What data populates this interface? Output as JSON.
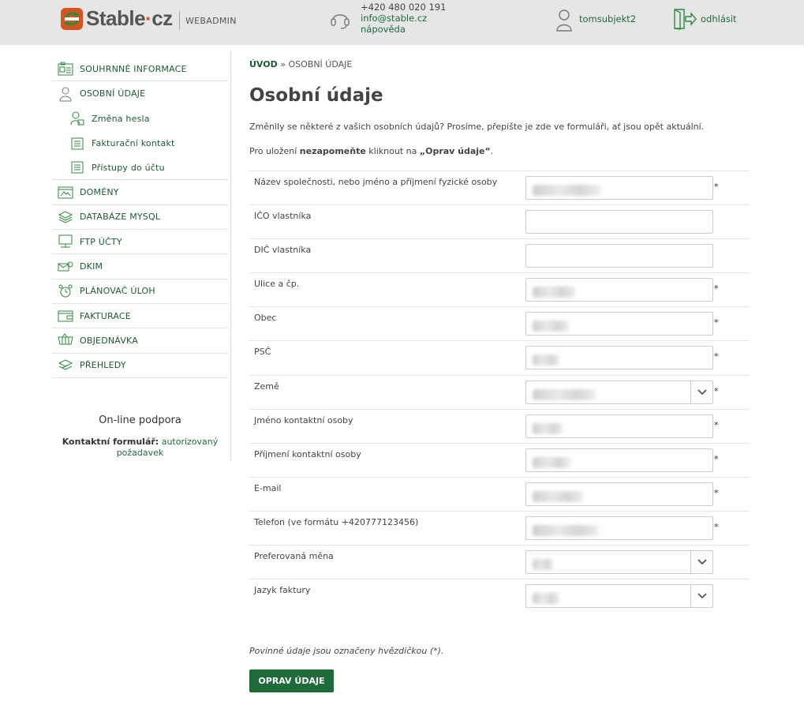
{
  "header": {
    "logo_text_main": "Stable",
    "logo_text_dot": "·",
    "logo_text_tld": "cz",
    "logo_sub": "WEBADMIN",
    "phone": "+420 480 020 191",
    "email": "info@stable.cz",
    "help": "nápověda",
    "username": "tomsubjekt2",
    "logout": "odhlásit"
  },
  "sidebar": {
    "items": [
      {
        "label": "SOUHRNNÉ INFORMACE",
        "icon": "summary-icon"
      },
      {
        "label": "OSOBNÍ ÚDAJE",
        "icon": "person-icon"
      },
      {
        "label": "Změna hesla",
        "icon": "password-user-icon"
      },
      {
        "label": "Fakturační kontakt",
        "icon": "document-icon"
      },
      {
        "label": "Přístupy do účtu",
        "icon": "document-icon"
      },
      {
        "label": "DOMÉNY",
        "icon": "domain-icon"
      },
      {
        "label": "DATABÁZE MYSQL",
        "icon": "database-icon"
      },
      {
        "label": "FTP ÚČTY",
        "icon": "ftp-icon"
      },
      {
        "label": "DKIM",
        "icon": "dkim-icon"
      },
      {
        "label": "PLÁNOVAČ ÚLOH",
        "icon": "alarm-clock-icon"
      },
      {
        "label": "FAKTURACE",
        "icon": "wallet-icon"
      },
      {
        "label": "OBJEDNÁVKA",
        "icon": "cart-icon"
      },
      {
        "label": "PŘEHLEDY",
        "icon": "stats-icon"
      }
    ],
    "support_title": "On-line podpora",
    "support_label": "Kontaktní formulář:",
    "support_link": "autorizovaný požadavek"
  },
  "main": {
    "breadcrumb_home": "ÚVOD",
    "breadcrumb_sep": " » ",
    "breadcrumb_current": "OSOBNÍ ÚDAJE",
    "title": "Osobní údaje",
    "intro": "Změnily se některé z vašich osobních údajů? Prosíme, přepište je zde ve formuláři, ať jsou opět aktuální.",
    "notice_pre": "Pro uložení ",
    "notice_bold": "nezapomeňte",
    "notice_mid": " kliknout na ",
    "notice_btn": "„Oprav údaje“",
    "notice_end": ".",
    "required_mark": "*",
    "required_note": "Povinné údaje jsou označeny hvězdičkou (*).",
    "submit": "OPRAV ÚDAJE",
    "fields": [
      {
        "label": "Název společnosti, nebo jméno a příjmení fyzické osoby"
      },
      {
        "label": "IČO vlastníka"
      },
      {
        "label": "DIČ vlastníka"
      },
      {
        "label": "Ulice a čp."
      },
      {
        "label": "Obec"
      },
      {
        "label": "PSČ"
      },
      {
        "label": "Země"
      },
      {
        "label": "Jméno kontaktní osoby"
      },
      {
        "label": "Příjmení kontaktní osoby"
      },
      {
        "label": "E-mail"
      },
      {
        "label": "Telefon (ve formátu +420777123456)"
      },
      {
        "label": "Preferovaná měna"
      },
      {
        "label": "Jazyk faktury"
      }
    ]
  },
  "colors": {
    "accent": "#1e6b3a",
    "logo_orange": "#d9531e",
    "header_bg": "#e6e6e6"
  }
}
